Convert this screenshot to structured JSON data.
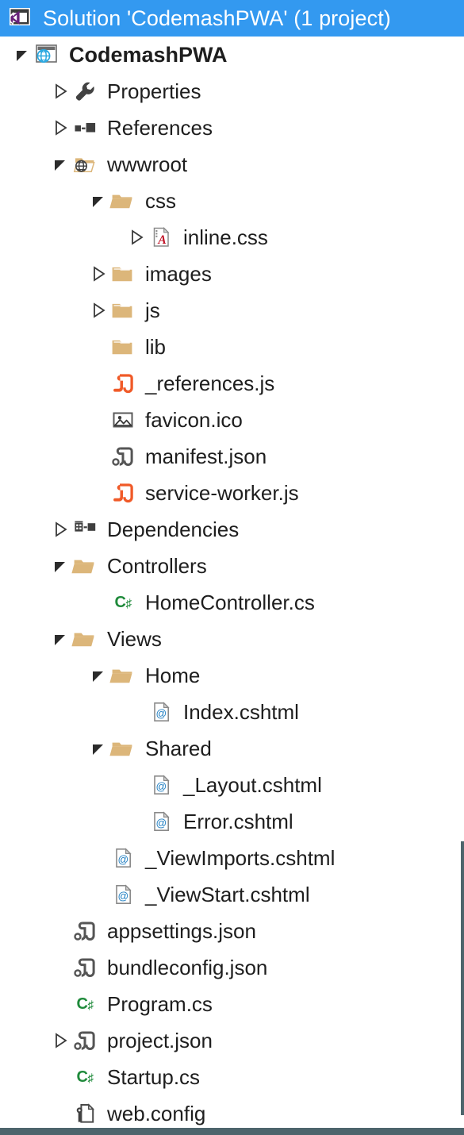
{
  "panel": {
    "name": "Solution Explorer",
    "accent_blue": "#3399f0",
    "chrome_border": "#4d646c",
    "folder_color": "#dcb67a",
    "js_color": "#f05a28",
    "json_color": "#555555",
    "csharp_color": "#1f8a3b"
  },
  "header": {
    "title": "Solution 'CodemashPWA' (1 project)",
    "icon": "visual-studio-solution-icon"
  },
  "tree": [
    {
      "label": "CodemashPWA",
      "indent": 0,
      "twisty": "expanded",
      "icon": "web-project-icon",
      "bold": true
    },
    {
      "label": "Properties",
      "indent": 1,
      "twisty": "collapsed",
      "icon": "wrench-icon",
      "bold": false
    },
    {
      "label": "References",
      "indent": 1,
      "twisty": "collapsed",
      "icon": "references-icon",
      "bold": false
    },
    {
      "label": "wwwroot",
      "indent": 1,
      "twisty": "expanded",
      "icon": "wwwroot-folder-icon",
      "bold": false
    },
    {
      "label": "css",
      "indent": 2,
      "twisty": "expanded",
      "icon": "folder-open-icon",
      "bold": false
    },
    {
      "label": "inline.css",
      "indent": 3,
      "twisty": "collapsed",
      "icon": "css-file-icon",
      "bold": false
    },
    {
      "label": "images",
      "indent": 2,
      "twisty": "collapsed",
      "icon": "folder-closed-icon",
      "bold": false
    },
    {
      "label": "js",
      "indent": 2,
      "twisty": "collapsed",
      "icon": "folder-closed-icon",
      "bold": false
    },
    {
      "label": "lib",
      "indent": 2,
      "twisty": "none",
      "icon": "folder-closed-icon",
      "bold": false
    },
    {
      "label": "_references.js",
      "indent": 2,
      "twisty": "none",
      "icon": "javascript-file-icon",
      "bold": false
    },
    {
      "label": "favicon.ico",
      "indent": 2,
      "twisty": "none",
      "icon": "image-file-icon",
      "bold": false
    },
    {
      "label": "manifest.json",
      "indent": 2,
      "twisty": "none",
      "icon": "json-file-icon",
      "bold": false
    },
    {
      "label": "service-worker.js",
      "indent": 2,
      "twisty": "none",
      "icon": "javascript-file-icon",
      "bold": false
    },
    {
      "label": "Dependencies",
      "indent": 1,
      "twisty": "collapsed",
      "icon": "dependencies-icon",
      "bold": false
    },
    {
      "label": "Controllers",
      "indent": 1,
      "twisty": "expanded",
      "icon": "folder-open-icon",
      "bold": false
    },
    {
      "label": "HomeController.cs",
      "indent": 2,
      "twisty": "none",
      "icon": "csharp-file-icon",
      "bold": false
    },
    {
      "label": "Views",
      "indent": 1,
      "twisty": "expanded",
      "icon": "folder-open-icon",
      "bold": false
    },
    {
      "label": "Home",
      "indent": 2,
      "twisty": "expanded",
      "icon": "folder-open-icon",
      "bold": false
    },
    {
      "label": "Index.cshtml",
      "indent": 3,
      "twisty": "none",
      "icon": "cshtml-file-icon",
      "bold": false
    },
    {
      "label": "Shared",
      "indent": 2,
      "twisty": "expanded",
      "icon": "folder-open-icon",
      "bold": false
    },
    {
      "label": "_Layout.cshtml",
      "indent": 3,
      "twisty": "none",
      "icon": "cshtml-file-icon",
      "bold": false
    },
    {
      "label": "Error.cshtml",
      "indent": 3,
      "twisty": "none",
      "icon": "cshtml-file-icon",
      "bold": false
    },
    {
      "label": "_ViewImports.cshtml",
      "indent": 2,
      "twisty": "none",
      "icon": "cshtml-file-icon",
      "bold": false
    },
    {
      "label": "_ViewStart.cshtml",
      "indent": 2,
      "twisty": "none",
      "icon": "cshtml-file-icon",
      "bold": false
    },
    {
      "label": "appsettings.json",
      "indent": 1,
      "twisty": "none",
      "icon": "json-file-icon",
      "bold": false
    },
    {
      "label": "bundleconfig.json",
      "indent": 1,
      "twisty": "none",
      "icon": "json-file-icon",
      "bold": false
    },
    {
      "label": "Program.cs",
      "indent": 1,
      "twisty": "none",
      "icon": "csharp-file-icon",
      "bold": false
    },
    {
      "label": "project.json",
      "indent": 1,
      "twisty": "collapsed",
      "icon": "json-file-icon",
      "bold": false
    },
    {
      "label": "Startup.cs",
      "indent": 1,
      "twisty": "none",
      "icon": "csharp-file-icon",
      "bold": false
    },
    {
      "label": "web.config",
      "indent": 1,
      "twisty": "none",
      "icon": "config-file-icon",
      "bold": false
    }
  ]
}
